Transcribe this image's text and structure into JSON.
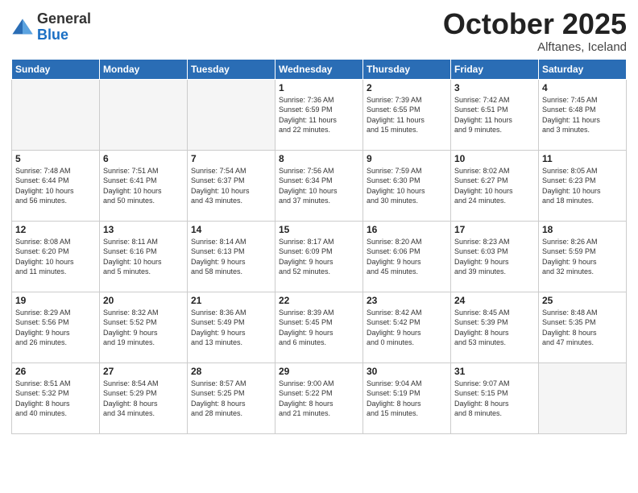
{
  "header": {
    "logo_general": "General",
    "logo_blue": "Blue",
    "month": "October 2025",
    "location": "Alftanes, Iceland"
  },
  "weekdays": [
    "Sunday",
    "Monday",
    "Tuesday",
    "Wednesday",
    "Thursday",
    "Friday",
    "Saturday"
  ],
  "weeks": [
    [
      {
        "day": "",
        "info": ""
      },
      {
        "day": "",
        "info": ""
      },
      {
        "day": "",
        "info": ""
      },
      {
        "day": "1",
        "info": "Sunrise: 7:36 AM\nSunset: 6:59 PM\nDaylight: 11 hours\nand 22 minutes."
      },
      {
        "day": "2",
        "info": "Sunrise: 7:39 AM\nSunset: 6:55 PM\nDaylight: 11 hours\nand 15 minutes."
      },
      {
        "day": "3",
        "info": "Sunrise: 7:42 AM\nSunset: 6:51 PM\nDaylight: 11 hours\nand 9 minutes."
      },
      {
        "day": "4",
        "info": "Sunrise: 7:45 AM\nSunset: 6:48 PM\nDaylight: 11 hours\nand 3 minutes."
      }
    ],
    [
      {
        "day": "5",
        "info": "Sunrise: 7:48 AM\nSunset: 6:44 PM\nDaylight: 10 hours\nand 56 minutes."
      },
      {
        "day": "6",
        "info": "Sunrise: 7:51 AM\nSunset: 6:41 PM\nDaylight: 10 hours\nand 50 minutes."
      },
      {
        "day": "7",
        "info": "Sunrise: 7:54 AM\nSunset: 6:37 PM\nDaylight: 10 hours\nand 43 minutes."
      },
      {
        "day": "8",
        "info": "Sunrise: 7:56 AM\nSunset: 6:34 PM\nDaylight: 10 hours\nand 37 minutes."
      },
      {
        "day": "9",
        "info": "Sunrise: 7:59 AM\nSunset: 6:30 PM\nDaylight: 10 hours\nand 30 minutes."
      },
      {
        "day": "10",
        "info": "Sunrise: 8:02 AM\nSunset: 6:27 PM\nDaylight: 10 hours\nand 24 minutes."
      },
      {
        "day": "11",
        "info": "Sunrise: 8:05 AM\nSunset: 6:23 PM\nDaylight: 10 hours\nand 18 minutes."
      }
    ],
    [
      {
        "day": "12",
        "info": "Sunrise: 8:08 AM\nSunset: 6:20 PM\nDaylight: 10 hours\nand 11 minutes."
      },
      {
        "day": "13",
        "info": "Sunrise: 8:11 AM\nSunset: 6:16 PM\nDaylight: 10 hours\nand 5 minutes."
      },
      {
        "day": "14",
        "info": "Sunrise: 8:14 AM\nSunset: 6:13 PM\nDaylight: 9 hours\nand 58 minutes."
      },
      {
        "day": "15",
        "info": "Sunrise: 8:17 AM\nSunset: 6:09 PM\nDaylight: 9 hours\nand 52 minutes."
      },
      {
        "day": "16",
        "info": "Sunrise: 8:20 AM\nSunset: 6:06 PM\nDaylight: 9 hours\nand 45 minutes."
      },
      {
        "day": "17",
        "info": "Sunrise: 8:23 AM\nSunset: 6:03 PM\nDaylight: 9 hours\nand 39 minutes."
      },
      {
        "day": "18",
        "info": "Sunrise: 8:26 AM\nSunset: 5:59 PM\nDaylight: 9 hours\nand 32 minutes."
      }
    ],
    [
      {
        "day": "19",
        "info": "Sunrise: 8:29 AM\nSunset: 5:56 PM\nDaylight: 9 hours\nand 26 minutes."
      },
      {
        "day": "20",
        "info": "Sunrise: 8:32 AM\nSunset: 5:52 PM\nDaylight: 9 hours\nand 19 minutes."
      },
      {
        "day": "21",
        "info": "Sunrise: 8:36 AM\nSunset: 5:49 PM\nDaylight: 9 hours\nand 13 minutes."
      },
      {
        "day": "22",
        "info": "Sunrise: 8:39 AM\nSunset: 5:45 PM\nDaylight: 9 hours\nand 6 minutes."
      },
      {
        "day": "23",
        "info": "Sunrise: 8:42 AM\nSunset: 5:42 PM\nDaylight: 9 hours\nand 0 minutes."
      },
      {
        "day": "24",
        "info": "Sunrise: 8:45 AM\nSunset: 5:39 PM\nDaylight: 8 hours\nand 53 minutes."
      },
      {
        "day": "25",
        "info": "Sunrise: 8:48 AM\nSunset: 5:35 PM\nDaylight: 8 hours\nand 47 minutes."
      }
    ],
    [
      {
        "day": "26",
        "info": "Sunrise: 8:51 AM\nSunset: 5:32 PM\nDaylight: 8 hours\nand 40 minutes."
      },
      {
        "day": "27",
        "info": "Sunrise: 8:54 AM\nSunset: 5:29 PM\nDaylight: 8 hours\nand 34 minutes."
      },
      {
        "day": "28",
        "info": "Sunrise: 8:57 AM\nSunset: 5:25 PM\nDaylight: 8 hours\nand 28 minutes."
      },
      {
        "day": "29",
        "info": "Sunrise: 9:00 AM\nSunset: 5:22 PM\nDaylight: 8 hours\nand 21 minutes."
      },
      {
        "day": "30",
        "info": "Sunrise: 9:04 AM\nSunset: 5:19 PM\nDaylight: 8 hours\nand 15 minutes."
      },
      {
        "day": "31",
        "info": "Sunrise: 9:07 AM\nSunset: 5:15 PM\nDaylight: 8 hours\nand 8 minutes."
      },
      {
        "day": "",
        "info": ""
      }
    ]
  ]
}
